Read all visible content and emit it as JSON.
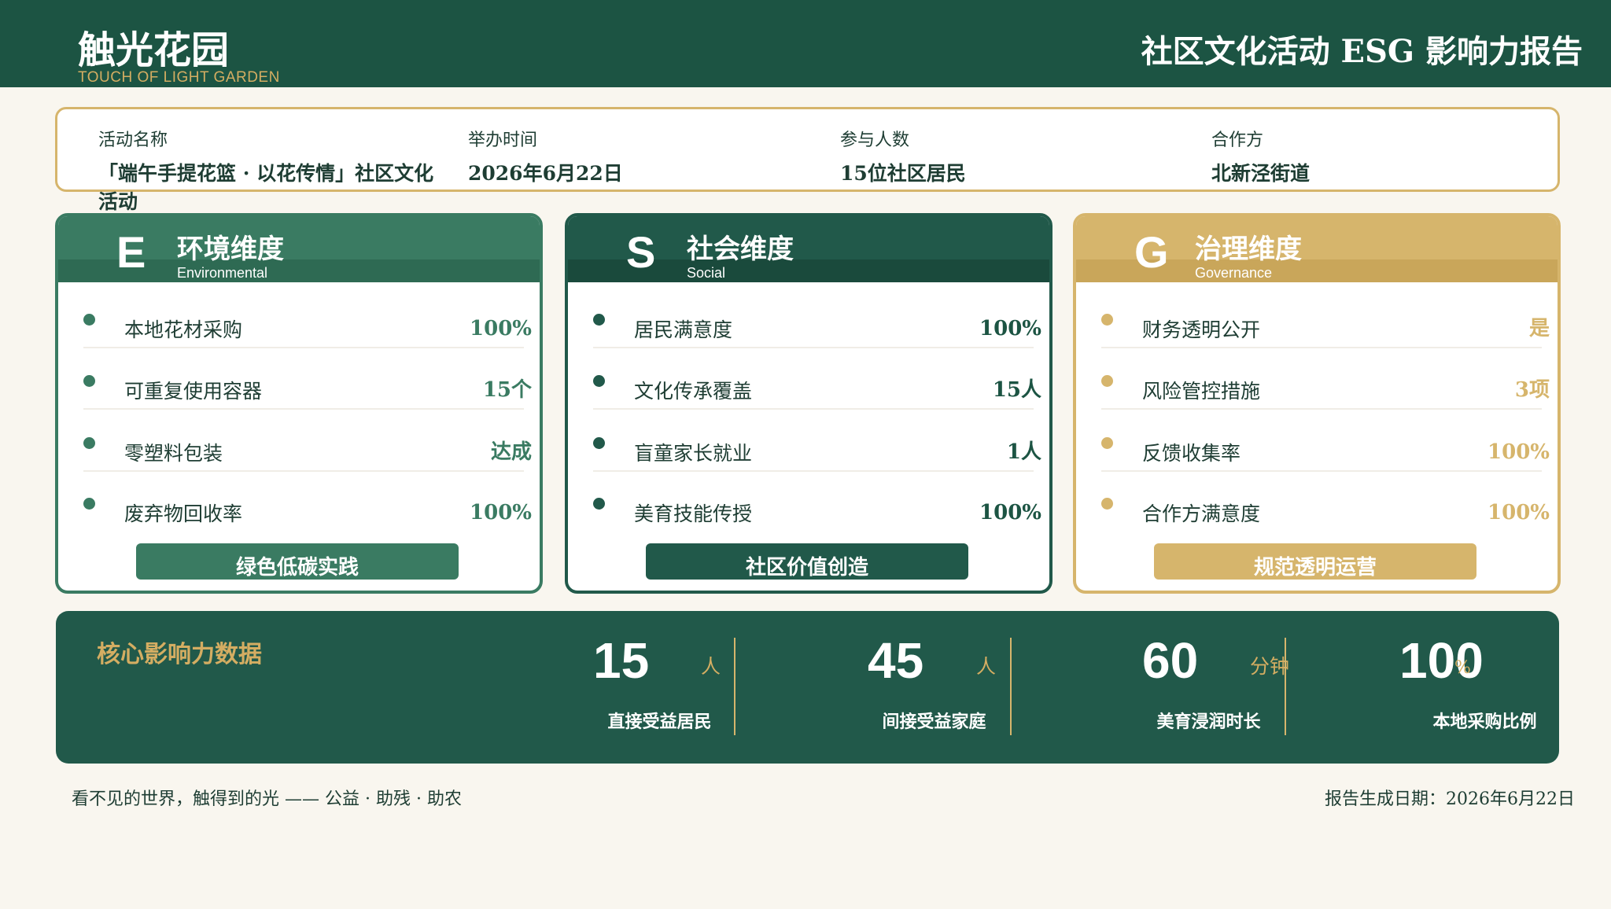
{
  "header": {
    "logo_cn": "触光花园",
    "logo_en": "TOUCH OF LIGHT GARDEN",
    "report_title": "社区文化活动 ESG 影响力报告"
  },
  "info": [
    {
      "label": "活动名称",
      "value": "「端午手提花篮 · 以花传情」社区文化活动"
    },
    {
      "label": "举办时间",
      "value": "2026年6月22日"
    },
    {
      "label": "参与人数",
      "value": "15位社区居民"
    },
    {
      "label": "合作方",
      "value": "北新泾街道"
    }
  ],
  "cards": {
    "e": {
      "letter": "E",
      "title": "环境维度",
      "subtitle": "Environmental",
      "metrics": [
        {
          "label": "本地花材采购",
          "value": "100%"
        },
        {
          "label": "可重复使用容器",
          "value": "15个"
        },
        {
          "label": "零塑料包装",
          "value": "达成"
        },
        {
          "label": "废弃物回收率",
          "value": "100%"
        }
      ],
      "button": "绿色低碳实践"
    },
    "s": {
      "letter": "S",
      "title": "社会维度",
      "subtitle": "Social",
      "metrics": [
        {
          "label": "居民满意度",
          "value": "100%"
        },
        {
          "label": "文化传承覆盖",
          "value": "15人"
        },
        {
          "label": "盲童家长就业",
          "value": "1人"
        },
        {
          "label": "美育技能传授",
          "value": "100%"
        }
      ],
      "button": "社区价值创造"
    },
    "g": {
      "letter": "G",
      "title": "治理维度",
      "subtitle": "Governance",
      "metrics": [
        {
          "label": "财务透明公开",
          "value": "是"
        },
        {
          "label": "风险管控措施",
          "value": "3项"
        },
        {
          "label": "反馈收集率",
          "value": "100%"
        },
        {
          "label": "合作方满意度",
          "value": "100%"
        }
      ],
      "button": "规范透明运营"
    }
  },
  "colors": {
    "header_green": "#1c5443",
    "e_green": "#3a7b62",
    "s_green": "#21594a",
    "g_gold": "#d6b56c",
    "accent_gold": "#d4ad62",
    "page_bg": "#f9f6ef"
  },
  "stats": {
    "title": "核心影响力数据",
    "items": [
      {
        "number": "15",
        "unit": "人",
        "label": "直接受益居民"
      },
      {
        "number": "45",
        "unit": "人",
        "label": "间接受益家庭"
      },
      {
        "number": "60",
        "unit": "分钟",
        "label": "美育浸润时长"
      },
      {
        "number": "100",
        "unit": "%",
        "label": "本地采购比例"
      }
    ]
  },
  "footer": {
    "slogan": "看不见的世界，触得到的光 —— 公益 · 助残 · 助农",
    "date": "报告生成日期：2026年6月22日"
  }
}
